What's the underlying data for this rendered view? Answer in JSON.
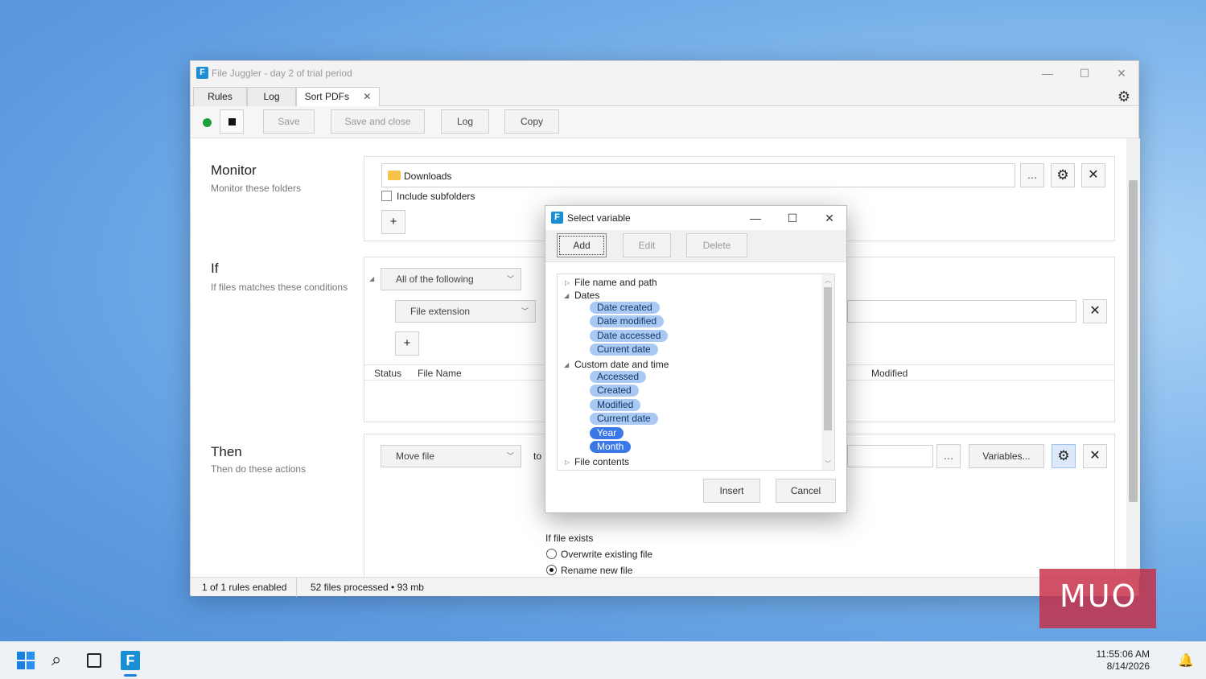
{
  "window": {
    "title": "File Juggler - day 2 of trial period",
    "logo_letter": "F",
    "controls": {
      "minimize": "—",
      "maximize": "☐",
      "close": "✕"
    }
  },
  "tabs": [
    {
      "label": "Rules"
    },
    {
      "label": "Log"
    },
    {
      "label": "Sort PDFs",
      "close": "✕"
    }
  ],
  "toolbar": {
    "save": "Save",
    "save_close": "Save and close",
    "log": "Log",
    "copy": "Copy",
    "status_color": "#1c9e3a"
  },
  "monitor": {
    "title": "Monitor",
    "subtitle": "Monitor these folders",
    "folder": "Downloads",
    "browse": "...",
    "include_subfolders": "Include subfolders",
    "add": "+"
  },
  "if": {
    "title": "If",
    "subtitle": "If files matches these conditions",
    "match_mode": "All of the following",
    "condition": "File extension",
    "add": "+",
    "columns": {
      "status": "Status",
      "file_name": "File Name",
      "modified": "Modified"
    }
  },
  "then": {
    "title": "Then",
    "subtitle": "Then do these actions",
    "action": "Move file",
    "to": "to",
    "browse": "...",
    "variables": "Variables...",
    "if_file_exists": "If file exists",
    "overwrite": "Overwrite existing file",
    "rename": "Rename new file"
  },
  "statusbar": {
    "rules": "1 of 1 rules enabled",
    "processed": "52 files processed • 93 mb"
  },
  "dialog": {
    "title": "Select variable",
    "add": "Add",
    "edit": "Edit",
    "delete": "Delete",
    "tree": {
      "file_name_path": "File name and path",
      "dates": "Dates",
      "dates_items": [
        "Date created",
        "Date modified",
        "Date accessed",
        "Current date"
      ],
      "custom": "Custom date and time",
      "custom_items": [
        "Accessed",
        "Created",
        "Modified",
        "Current date",
        "Year",
        "Month"
      ],
      "file_contents": "File contents"
    },
    "insert": "Insert",
    "cancel": "Cancel"
  },
  "watermark": "MUO",
  "taskbar": {
    "time": "11:55:06 AM",
    "date": "8/14/2026"
  }
}
